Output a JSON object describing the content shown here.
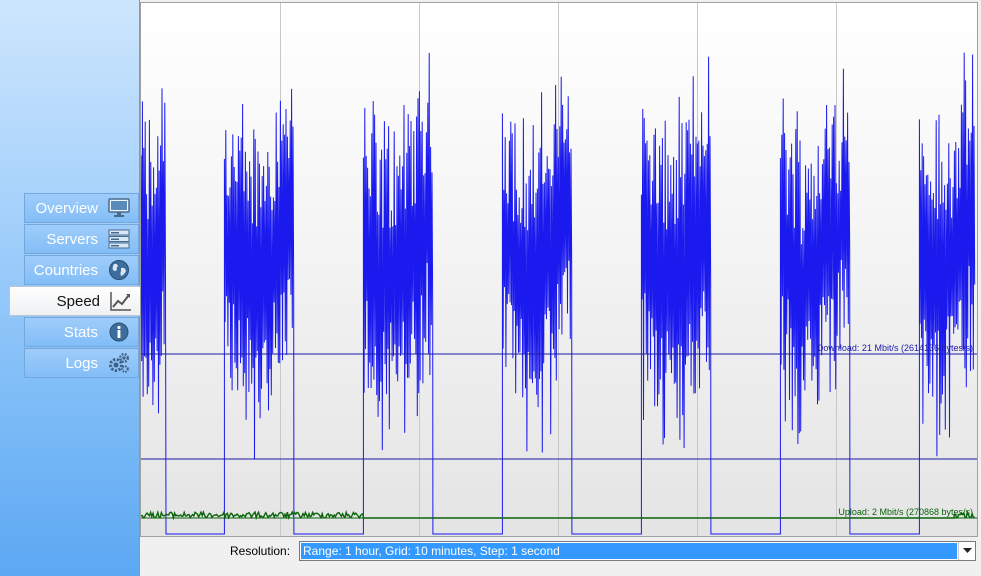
{
  "sidebar": {
    "items": [
      {
        "label": "Overview",
        "icon": "monitor-icon",
        "active": false
      },
      {
        "label": "Servers",
        "icon": "servers-icon",
        "active": false
      },
      {
        "label": "Countries",
        "icon": "globe-icon",
        "active": false
      },
      {
        "label": "Speed",
        "icon": "chart-line-icon",
        "active": true
      },
      {
        "label": "Stats",
        "icon": "info-icon",
        "active": false
      },
      {
        "label": "Logs",
        "icon": "gears-icon",
        "active": false
      }
    ]
  },
  "chart_data": {
    "type": "line",
    "title": "",
    "xlabel": "",
    "ylabel": "",
    "grid": true,
    "x_range_minutes": [
      0,
      60
    ],
    "grid_interval_minutes": 10,
    "series": [
      {
        "name": "Download",
        "color": "#1a1aee",
        "bursts_minutes": [
          [
            0,
            1.8
          ],
          [
            6,
            11
          ],
          [
            16,
            21
          ],
          [
            26,
            31
          ],
          [
            36,
            41
          ],
          [
            46,
            51
          ],
          [
            56,
            60
          ]
        ]
      },
      {
        "name": "Upload",
        "color": "#0a640a",
        "active_ranges_minutes": [
          [
            0,
            16
          ],
          [
            58.5,
            60
          ]
        ]
      }
    ],
    "reference_lines": [
      {
        "label": "Download: 21 Mbit/s (2614136 bytes/s)",
        "color": "#1a1aaa"
      },
      {
        "label": "Upload: 2 Mbit/s (270868 bytes/s)",
        "color": "#0a640a"
      }
    ]
  },
  "resolution": {
    "label": "Resolution:",
    "value": "Range: 1 hour, Grid: 10 minutes, Step: 1 second"
  },
  "colors": {
    "accent": "#3399ff",
    "download": "#1a1aee",
    "upload": "#0a640a",
    "sidebar_top": "#cde6fd",
    "sidebar_bottom": "#5ca8f3"
  }
}
